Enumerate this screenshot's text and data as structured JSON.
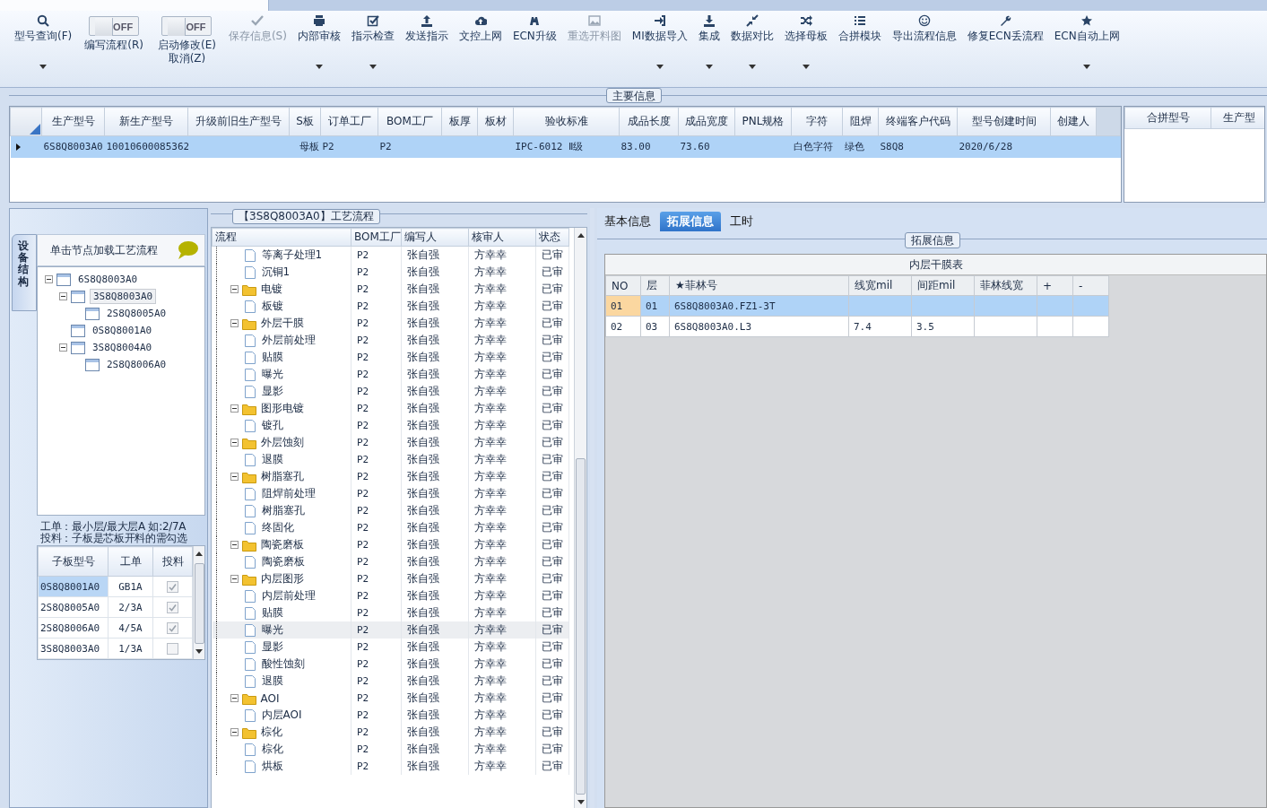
{
  "toolbar": [
    {
      "kind": "button",
      "lines": [
        "型号查询(F)"
      ],
      "disabled": false,
      "has_menu": true
    },
    {
      "kind": "toggle",
      "switch_text": "OFF",
      "on": false,
      "lines": [
        "编写流程(R)"
      ]
    },
    {
      "kind": "toggle",
      "switch_text": "OFF",
      "on": false,
      "lines": [
        "启动修改(E)",
        "取消(Z)"
      ]
    },
    {
      "kind": "button",
      "lines": [
        "保存信息(S)"
      ],
      "disabled": true,
      "has_menu": false
    },
    {
      "kind": "button",
      "lines": [
        "内部审核"
      ],
      "disabled": false,
      "has_menu": true
    },
    {
      "kind": "button",
      "lines": [
        "指示检查"
      ],
      "disabled": false,
      "has_menu": true
    },
    {
      "kind": "button",
      "lines": [
        "发送指示"
      ],
      "disabled": false,
      "has_menu": false
    },
    {
      "kind": "button",
      "lines": [
        "文控上网"
      ],
      "disabled": false,
      "has_menu": false
    },
    {
      "kind": "button",
      "lines": [
        "ECN升级"
      ],
      "disabled": false,
      "has_menu": false
    },
    {
      "kind": "button",
      "lines": [
        "重选开料图"
      ],
      "disabled": true,
      "has_menu": false
    },
    {
      "kind": "button",
      "lines": [
        "MI数据导入"
      ],
      "disabled": false,
      "has_menu": true
    },
    {
      "kind": "button",
      "lines": [
        "集成"
      ],
      "disabled": false,
      "has_menu": true
    },
    {
      "kind": "button",
      "lines": [
        "数据对比"
      ],
      "disabled": false,
      "has_menu": true
    },
    {
      "kind": "button",
      "lines": [
        "选择母板"
      ],
      "disabled": false,
      "has_menu": true
    },
    {
      "kind": "button",
      "lines": [
        "合拼模块"
      ],
      "disabled": false,
      "has_menu": false
    },
    {
      "kind": "button",
      "lines": [
        "导出流程信息"
      ],
      "disabled": false,
      "has_menu": false
    },
    {
      "kind": "button",
      "lines": [
        "修复ECN丢流程"
      ],
      "disabled": false,
      "has_menu": false
    },
    {
      "kind": "button",
      "lines": [
        "ECN自动上网"
      ],
      "disabled": false,
      "has_menu": true
    }
  ],
  "main_info": {
    "title": "主要信息",
    "columns": [
      "生产型号",
      "新生产型号",
      "升级前旧生产型号",
      "S板",
      "订单工厂",
      "BOM工厂",
      "板厚",
      "板材",
      "验收标准",
      "成品长度",
      "成品宽度",
      "PNL规格",
      "字符",
      "阻焊",
      "终端客户代码",
      "型号创建时间",
      "创建人"
    ],
    "rows": [
      {
        "selected": true,
        "cells": [
          "6S8Q8003A0",
          "10010600085362",
          "",
          "母板",
          "P2",
          "P2",
          "",
          "",
          "IPC-6012 Ⅱ级",
          "83.00",
          "73.60",
          "",
          "白色字符",
          "绿色",
          "S8Q8",
          "2020/6/28",
          ""
        ]
      }
    ],
    "side_columns": [
      "合拼型号",
      "生产型"
    ]
  },
  "structure_panel": {
    "tab": "设备结构",
    "hint": "单击节点加载工艺流程",
    "tree": [
      {
        "label": "6S8Q8003A0",
        "expanded": true,
        "selected": false,
        "children": [
          {
            "label": "3S8Q8003A0",
            "expanded": true,
            "selected": true,
            "children": [
              {
                "label": "2S8Q8005A0",
                "selected": false
              }
            ]
          },
          {
            "label": "0S8Q8001A0",
            "selected": false
          },
          {
            "label": "3S8Q8004A0",
            "expanded": true,
            "selected": false,
            "children": [
              {
                "label": "2S8Q8006A0",
                "selected": false
              }
            ]
          }
        ]
      }
    ],
    "notes": [
      "工单：最小层/最大层A 如:2/7A",
      "投料：子板是芯板开料的需勾选"
    ],
    "columns": [
      "子板型号",
      "工单",
      "投料"
    ],
    "rows": [
      {
        "board": "0S8Q8001A0",
        "order": "GB1A",
        "checked": true,
        "selected": true
      },
      {
        "board": "2S8Q8005A0",
        "order": "2/3A",
        "checked": true,
        "selected": false
      },
      {
        "board": "2S8Q8006A0",
        "order": "4/5A",
        "checked": true,
        "selected": false
      },
      {
        "board": "3S8Q8003A0",
        "order": "1/3A",
        "checked": false,
        "selected": false
      }
    ]
  },
  "process_panel": {
    "title": "【3S8Q8003A0】工艺流程",
    "columns": [
      "流程",
      "BOM工厂",
      "编写人",
      "核审人",
      "状态"
    ],
    "tree": [
      {
        "children": [
          {
            "name": "等离子处理1",
            "bom": "P2",
            "writer": "张自强",
            "reviewer": "方幸幸",
            "status": "已审",
            "selected": false
          },
          {
            "name": "沉铜1",
            "bom": "P2",
            "writer": "张自强",
            "reviewer": "方幸幸",
            "status": "已审",
            "selected": false
          }
        ]
      },
      {
        "name": "电镀",
        "bom": "P2",
        "writer": "张自强",
        "reviewer": "方幸幸",
        "status": "已审",
        "selected": false,
        "expanded": true,
        "children": [
          {
            "name": "板镀",
            "bom": "P2",
            "writer": "张自强",
            "reviewer": "方幸幸",
            "status": "已审",
            "selected": false
          }
        ]
      },
      {
        "name": "外层干膜",
        "bom": "P2",
        "writer": "张自强",
        "reviewer": "方幸幸",
        "status": "已审",
        "selected": false,
        "expanded": true,
        "children": [
          {
            "name": "外层前处理",
            "bom": "P2",
            "writer": "张自强",
            "reviewer": "方幸幸",
            "status": "已审",
            "selected": false
          },
          {
            "name": "贴膜",
            "bom": "P2",
            "writer": "张自强",
            "reviewer": "方幸幸",
            "status": "已审",
            "selected": false
          },
          {
            "name": "曝光",
            "bom": "P2",
            "writer": "张自强",
            "reviewer": "方幸幸",
            "status": "已审",
            "selected": false
          },
          {
            "name": "显影",
            "bom": "P2",
            "writer": "张自强",
            "reviewer": "方幸幸",
            "status": "已审",
            "selected": false
          }
        ]
      },
      {
        "name": "图形电镀",
        "bom": "P2",
        "writer": "张自强",
        "reviewer": "方幸幸",
        "status": "已审",
        "selected": false,
        "expanded": true,
        "children": [
          {
            "name": "镀孔",
            "bom": "P2",
            "writer": "张自强",
            "reviewer": "方幸幸",
            "status": "已审",
            "selected": false
          }
        ]
      },
      {
        "name": "外层蚀刻",
        "bom": "P2",
        "writer": "张自强",
        "reviewer": "方幸幸",
        "status": "已审",
        "selected": false,
        "expanded": true,
        "children": [
          {
            "name": "退膜",
            "bom": "P2",
            "writer": "张自强",
            "reviewer": "方幸幸",
            "status": "已审",
            "selected": false
          }
        ]
      },
      {
        "name": "树脂塞孔",
        "bom": "P2",
        "writer": "张自强",
        "reviewer": "方幸幸",
        "status": "已审",
        "selected": false,
        "expanded": true,
        "children": [
          {
            "name": "阻焊前处理",
            "bom": "P2",
            "writer": "张自强",
            "reviewer": "方幸幸",
            "status": "已审",
            "selected": false
          },
          {
            "name": "树脂塞孔",
            "bom": "P2",
            "writer": "张自强",
            "reviewer": "方幸幸",
            "status": "已审",
            "selected": false
          },
          {
            "name": "终固化",
            "bom": "P2",
            "writer": "张自强",
            "reviewer": "方幸幸",
            "status": "已审",
            "selected": false
          }
        ]
      },
      {
        "name": "陶瓷磨板",
        "bom": "P2",
        "writer": "张自强",
        "reviewer": "方幸幸",
        "status": "已审",
        "selected": false,
        "expanded": true,
        "children": [
          {
            "name": "陶瓷磨板",
            "bom": "P2",
            "writer": "张自强",
            "reviewer": "方幸幸",
            "status": "已审",
            "selected": false
          }
        ]
      },
      {
        "name": "内层图形",
        "bom": "P2",
        "writer": "张自强",
        "reviewer": "方幸幸",
        "status": "已审",
        "selected": false,
        "expanded": true,
        "children": [
          {
            "name": "内层前处理",
            "bom": "P2",
            "writer": "张自强",
            "reviewer": "方幸幸",
            "status": "已审",
            "selected": false
          },
          {
            "name": "贴膜",
            "bom": "P2",
            "writer": "张自强",
            "reviewer": "方幸幸",
            "status": "已审",
            "selected": false
          },
          {
            "name": "曝光",
            "bom": "P2",
            "writer": "张自强",
            "reviewer": "方幸幸",
            "status": "已审",
            "selected": true
          },
          {
            "name": "显影",
            "bom": "P2",
            "writer": "张自强",
            "reviewer": "方幸幸",
            "status": "已审",
            "selected": false
          },
          {
            "name": "酸性蚀刻",
            "bom": "P2",
            "writer": "张自强",
            "reviewer": "方幸幸",
            "status": "已审",
            "selected": false
          },
          {
            "name": "退膜",
            "bom": "P2",
            "writer": "张自强",
            "reviewer": "方幸幸",
            "status": "已审",
            "selected": false
          }
        ]
      },
      {
        "name": "AOI",
        "bom": "P2",
        "writer": "张自强",
        "reviewer": "方幸幸",
        "status": "已审",
        "selected": false,
        "expanded": true,
        "children": [
          {
            "name": "内层AOI",
            "bom": "P2",
            "writer": "张自强",
            "reviewer": "方幸幸",
            "status": "已审",
            "selected": false
          }
        ]
      },
      {
        "name": "棕化",
        "bom": "P2",
        "writer": "张自强",
        "reviewer": "方幸幸",
        "status": "已审",
        "selected": false,
        "expanded": true,
        "children": [
          {
            "name": "棕化",
            "bom": "P2",
            "writer": "张自强",
            "reviewer": "方幸幸",
            "status": "已审",
            "selected": false
          },
          {
            "name": "烘板",
            "bom": "P2",
            "writer": "张自强",
            "reviewer": "方幸幸",
            "status": "已审",
            "selected": false
          }
        ]
      }
    ]
  },
  "detail_panel": {
    "tabs": [
      {
        "label": "基本信息",
        "selected": false
      },
      {
        "label": "拓展信息",
        "selected": true
      },
      {
        "label": "工时",
        "selected": false
      }
    ],
    "group_title": "拓展信息",
    "table_title": "内层干膜表",
    "columns": [
      "NO",
      "层",
      "★菲林号",
      "线宽mil",
      "间距mil",
      "菲林线宽",
      "+",
      "-"
    ],
    "rows": [
      {
        "selected": true,
        "cells": [
          "01",
          "01",
          "6S8Q8003A0.FZ1-3T",
          "",
          "",
          "",
          "",
          ""
        ]
      },
      {
        "selected": false,
        "cells": [
          "02",
          "03",
          "6S8Q8003A0.L3",
          "7.4",
          "3.5",
          "",
          "",
          ""
        ]
      }
    ]
  }
}
